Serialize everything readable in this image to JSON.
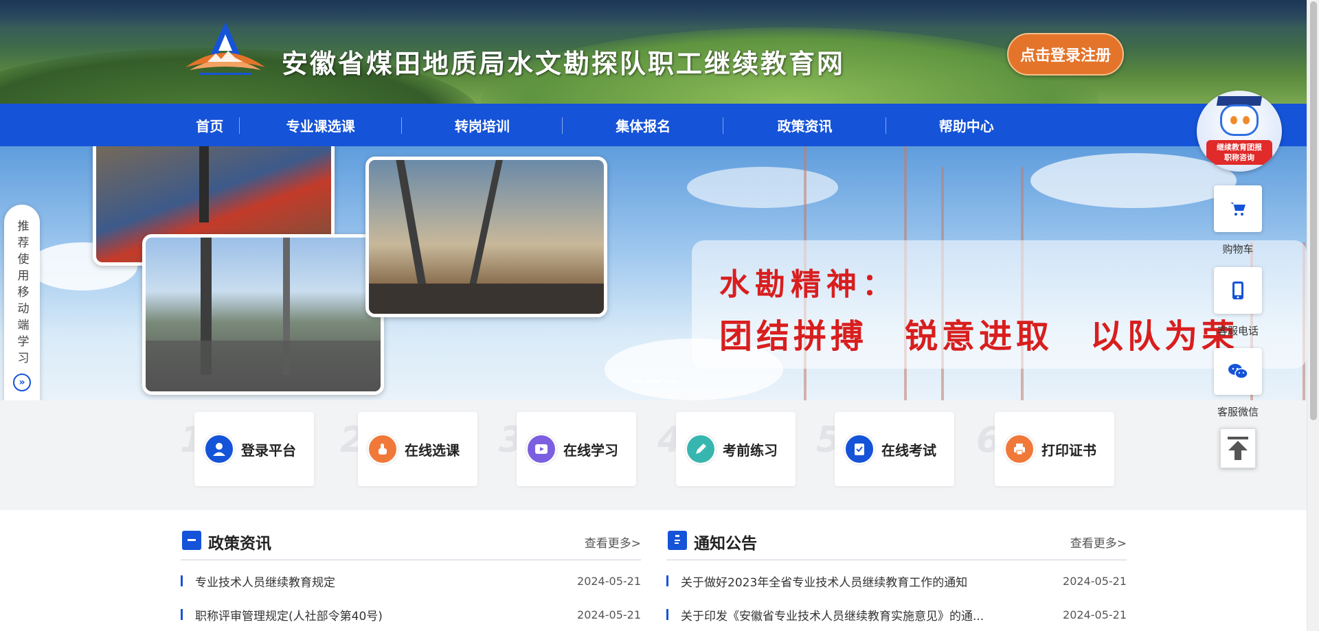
{
  "header": {
    "site_title": "安徽省煤田地质局水文勘探队职工继续教育网",
    "login_button": "点击登录注册"
  },
  "nav": {
    "items": [
      {
        "label": "首页"
      },
      {
        "label": "专业课选课"
      },
      {
        "label": "转岗培训"
      },
      {
        "label": "集体报名"
      },
      {
        "label": "政策资讯"
      },
      {
        "label": "帮助中心"
      }
    ]
  },
  "banner": {
    "slogan_line1": "水勘精神：",
    "slogan_line2": "团结拼搏　锐意进取　以队为荣",
    "active_slide": 2,
    "slide_count": 3
  },
  "side_hint": {
    "text": "推荐使用移动端学习",
    "arrow_icon": "double-chevron-right-icon"
  },
  "steps": [
    {
      "num": "1",
      "label": "登录平台",
      "icon": "user-icon",
      "color": "#1553d8"
    },
    {
      "num": "2",
      "label": "在线选课",
      "icon": "pointer-hand-icon",
      "color": "#f0793a"
    },
    {
      "num": "3",
      "label": "在线学习",
      "icon": "video-play-icon",
      "color": "#7b5fe0"
    },
    {
      "num": "4",
      "label": "考前练习",
      "icon": "pencil-icon",
      "color": "#37b6b0"
    },
    {
      "num": "5",
      "label": "在线考试",
      "icon": "checklist-icon",
      "color": "#1553d8"
    },
    {
      "num": "6",
      "label": "打印证书",
      "icon": "printer-icon",
      "color": "#f0793a"
    }
  ],
  "policy": {
    "title": "政策资讯",
    "more": "查看更多>",
    "items": [
      {
        "title": "专业技术人员继续教育规定",
        "date": "2024-05-21"
      },
      {
        "title": "职称评审管理规定(人社部令第40号)",
        "date": "2024-05-21"
      }
    ]
  },
  "notice": {
    "title": "通知公告",
    "more": "查看更多>",
    "items": [
      {
        "title": "关于做好2023年全省专业技术人员继续教育工作的通知",
        "date": "2024-05-21"
      },
      {
        "title": "关于印发《安徽省专业技术人员继续教育实施意见》的通...",
        "date": "2024-05-21"
      }
    ]
  },
  "floating": {
    "robot_tag": "继续教育团报\n职称咨询",
    "cart": "购物车",
    "phone": "客服电话",
    "wechat": "客服微信"
  },
  "colors": {
    "primary": "#1553d8",
    "accent": "#e4742a",
    "slogan": "#d81e1e"
  }
}
